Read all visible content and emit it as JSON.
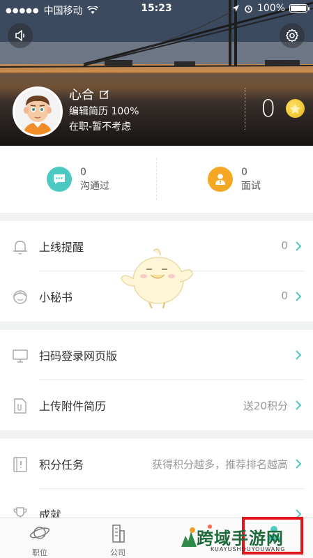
{
  "status_bar": {
    "carrier": "中国移动",
    "time": "15:23",
    "battery": "100%"
  },
  "profile": {
    "name": "心合",
    "resume_completeness": "编辑简历 100%",
    "job_status": "在职-暂不考虑",
    "coins": "0"
  },
  "stats": [
    {
      "count": "0",
      "label": "沟通过"
    },
    {
      "count": "0",
      "label": "面试"
    }
  ],
  "menu_group_1": [
    {
      "label": "上线提醒",
      "value": "0"
    },
    {
      "label": "小秘书",
      "value": "0"
    }
  ],
  "menu_group_2": [
    {
      "label": "扫码登录网页版",
      "value": ""
    },
    {
      "label": "上传附件简历",
      "value": "送20积分"
    }
  ],
  "menu_group_3": [
    {
      "label": "积分任务",
      "value": "获得积分越多，推荐排名越高"
    },
    {
      "label": "成就",
      "value": ""
    }
  ],
  "tabs": [
    {
      "label": "职位",
      "icon": "planet-icon"
    },
    {
      "label": "公司",
      "icon": "building-icon"
    },
    {
      "label": "",
      "icon": "chat-icon"
    },
    {
      "label": "",
      "icon": "me-icon"
    }
  ],
  "watermark": {
    "title": "跨域手游网",
    "subtitle": "KUAYUSHOUYOUWANG"
  },
  "colors": {
    "teal": "#4cc9c0",
    "orange": "#f5a623",
    "highlight_box": "#e0181e"
  }
}
